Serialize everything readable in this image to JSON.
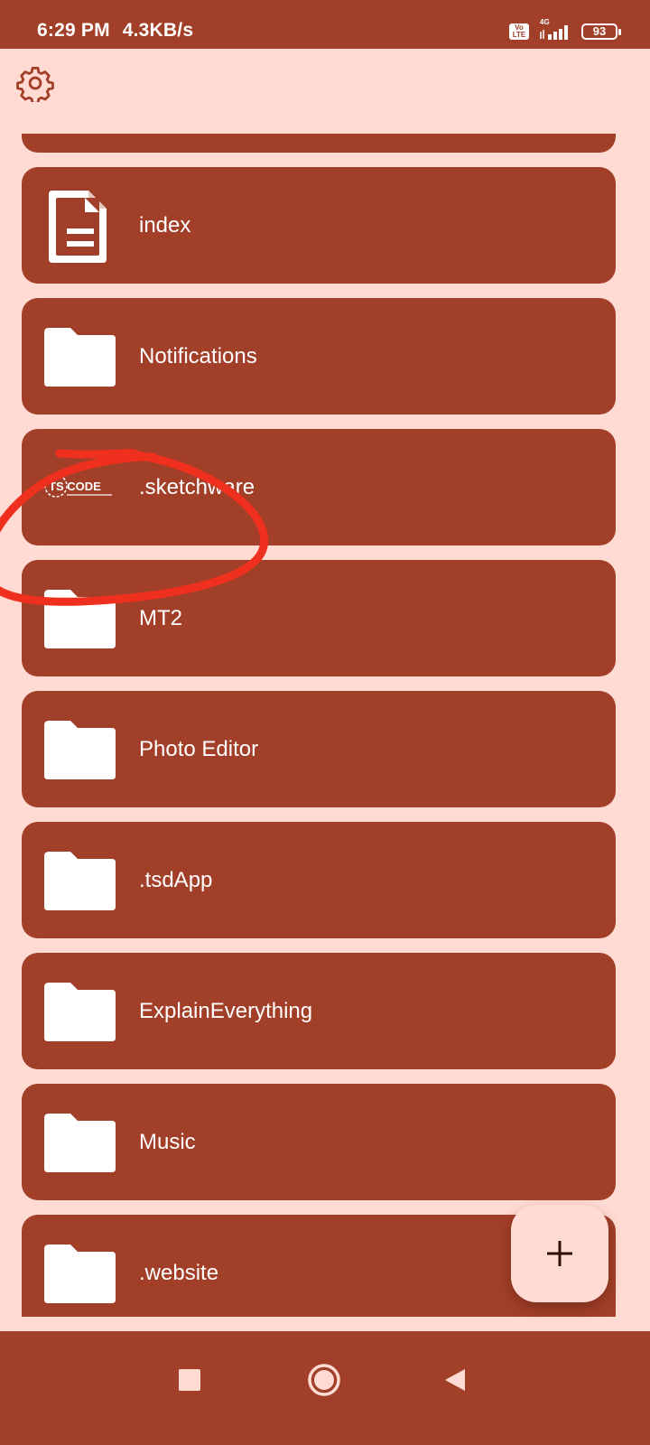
{
  "status_bar": {
    "time": "6:29 PM",
    "speed": "4.3KB/s",
    "volte_label": "Vo LTE",
    "network": "4G",
    "battery": "93"
  },
  "toolbar": {
    "settings_icon": "gear-icon"
  },
  "files": [
    {
      "name": "",
      "icon": "folder-icon"
    },
    {
      "name": "index",
      "icon": "document-icon"
    },
    {
      "name": "Notifications",
      "icon": "folder-icon"
    },
    {
      "name": ".sketchware",
      "icon": "ts-code-logo"
    },
    {
      "name": "MT2",
      "icon": "folder-icon"
    },
    {
      "name": "Photo Editor",
      "icon": "folder-icon"
    },
    {
      "name": ".tsdApp",
      "icon": "folder-icon"
    },
    {
      "name": "ExplainEverything",
      "icon": "folder-icon"
    },
    {
      "name": "Music",
      "icon": "folder-icon"
    },
    {
      "name": ".website",
      "icon": "folder-icon"
    }
  ],
  "logo_text": "TS CODE",
  "fab": {
    "icon": "plus-icon"
  },
  "navigation": {
    "recents_icon": "square-icon",
    "home_icon": "circle-icon",
    "back_icon": "triangle-back-icon"
  },
  "colors": {
    "primary": "#a23f29",
    "background": "#ffdbd3",
    "annotation": "#f0301e"
  }
}
